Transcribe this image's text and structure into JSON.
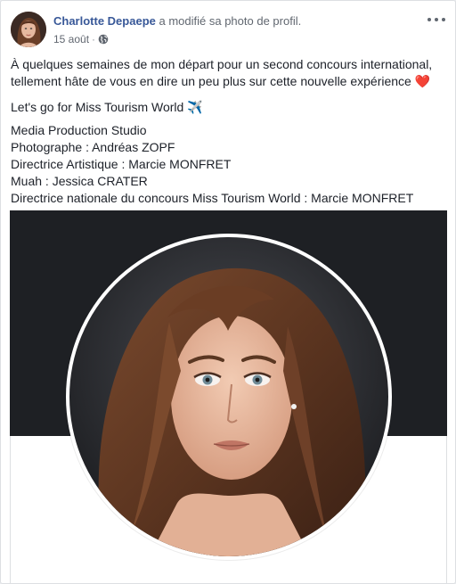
{
  "post": {
    "author": "Charlotte Depaepe",
    "action": "a modifié sa photo de profil.",
    "date": "15 août",
    "separator": "·",
    "privacy_icon": "globe-icon",
    "more_icon": "more-options-icon"
  },
  "content": {
    "para1_line1": "À quelques semaines de mon départ pour un second concours international,",
    "para1_line2": "tellement hâte de vous en dire un peu plus sur cette nouvelle expérience",
    "heart": "❤️",
    "para2": "Let's go for Miss Tourism World",
    "plane": "✈️",
    "credits": [
      "Media Production Studio",
      "Photographe : Andréas ZOPF",
      "Directrice Artistique : Marcie MONFRET",
      "Muah : Jessica CRATER",
      "Directrice nationale du concours Miss Tourism World : Marcie MONFRET"
    ]
  },
  "colors": {
    "author": "#385898",
    "text": "#1d2129",
    "meta": "#616770",
    "cover": "#1e2024"
  }
}
